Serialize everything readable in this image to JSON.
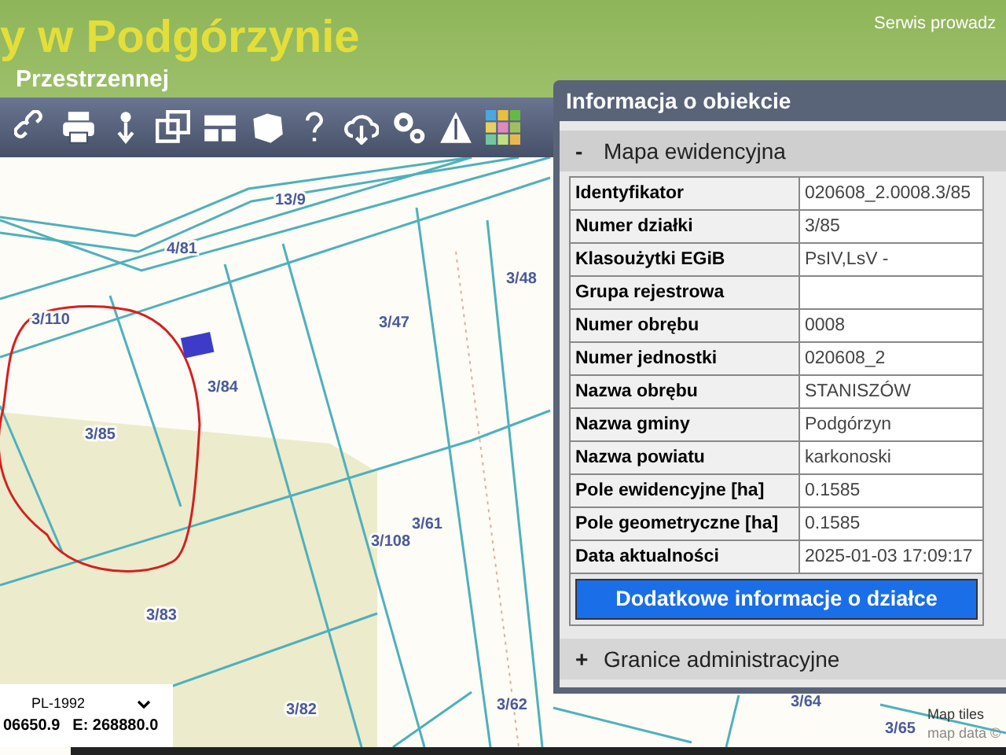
{
  "header": {
    "title": "y w Podgórzynie",
    "subtitle": "Przestrzennej",
    "service_note": "Serwis prowadz"
  },
  "map": {
    "parcels": [
      "13/9",
      "4/81",
      "3/110",
      "3/84",
      "3/85",
      "3/47",
      "3/48",
      "3/108",
      "3/61",
      "3/83",
      "3/82",
      "3/62",
      "3/64",
      "3/65"
    ],
    "attribution": [
      "Map tiles",
      "map data ©"
    ]
  },
  "coordinates": {
    "system": "PL-1992",
    "north": "06650.9",
    "east": "E: 268880.0"
  },
  "info_panel": {
    "title": "Informacja o obiekcie",
    "sections": [
      {
        "toggle": "-",
        "title": "Mapa ewidencyjna",
        "expanded": true,
        "rows": [
          {
            "label": "Identyfikator",
            "value": "020608_2.0008.3/85"
          },
          {
            "label": "Numer działki",
            "value": "3/85"
          },
          {
            "label": "Klasoużytki EGiB",
            "value": "PsIV,LsV -"
          },
          {
            "label": "Grupa rejestrowa"
          },
          {
            "label": "Numer obrębu",
            "value": "0008"
          },
          {
            "label": "Numer jednostki",
            "value": "020608_2"
          },
          {
            "label": "Nazwa obrębu",
            "value": "STANISZÓW"
          },
          {
            "label": "Nazwa gminy",
            "value": "Podgórzyn"
          },
          {
            "label": "Nazwa powiatu",
            "value": "karkonoski"
          },
          {
            "label": "Pole ewidencyjne [ha]",
            "value": "0.1585"
          },
          {
            "label": "Pole geometryczne [ha]",
            "value": "0.1585"
          },
          {
            "label": "Data aktualności",
            "value": "2025-01-03 17:09:17"
          }
        ],
        "button": "Dodatkowe informacje o działce"
      },
      {
        "toggle": "+",
        "title": "Granice administracyjne",
        "expanded": false
      }
    ]
  }
}
